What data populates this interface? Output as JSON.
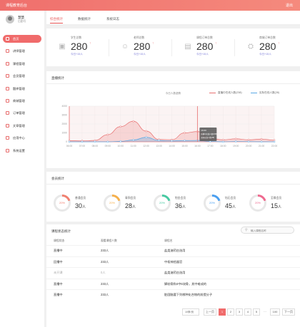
{
  "topbar": {
    "brand": "课程教育后台",
    "logout": "退出"
  },
  "user": {
    "name": "慧慧",
    "role": "后勤号"
  },
  "nav": [
    {
      "label": "首页",
      "icon": "home-icon",
      "active": true
    },
    {
      "label": "讲师管理",
      "icon": "teacher-icon"
    },
    {
      "label": "课程管理",
      "icon": "course-icon"
    },
    {
      "label": "会员管理",
      "icon": "member-icon"
    },
    {
      "label": "题库管理",
      "icon": "question-bank-icon"
    },
    {
      "label": "商城管理",
      "icon": "shop-icon"
    },
    {
      "label": "订单管理",
      "icon": "order-icon"
    },
    {
      "label": "文章管理",
      "icon": "article-icon"
    },
    {
      "label": "应用中心",
      "icon": "app-icon"
    },
    {
      "label": "系统设置",
      "icon": "settings-icon"
    }
  ],
  "tabs": [
    {
      "label": "综合统计",
      "active": true
    },
    {
      "label": "数据统计"
    },
    {
      "label": "系统日志"
    }
  ],
  "stats": [
    {
      "label": "学生总数",
      "value": "280",
      "delta": "今日+15人",
      "icon": "graduation-cap-icon"
    },
    {
      "label": "老师总数",
      "value": "280",
      "delta": "今日+15人",
      "icon": "teacher-icon"
    },
    {
      "label": "课程订单总数",
      "value": "280",
      "delta": "今日+15人",
      "icon": "book-icon"
    },
    {
      "label": "商城订单总数",
      "value": "280",
      "delta": "今日+15人",
      "icon": "cart-icon"
    }
  ],
  "live": {
    "title": "直播统计",
    "subtitle": "今日人数趋势",
    "legend": [
      "直播中在线人数(238)",
      "实际在线人数(28)"
    ],
    "tooltip": {
      "time": "16:00",
      "line1": "直播中在线人数(238)",
      "line2": "实际在线人数(28)"
    }
  },
  "chart_data": {
    "type": "area",
    "title": "今日人数趋势",
    "x": [
      "06:00",
      "07:00",
      "08:00",
      "09:00",
      "10:00",
      "11:00",
      "12:00",
      "13:00",
      "14:00",
      "15:00",
      "16:00",
      "17:00",
      "18:00",
      "19:00",
      "20:00",
      "21:00",
      "22:00"
    ],
    "series": [
      {
        "name": "直播中在线人数(238)",
        "color": "#e86f6f",
        "values": [
          120,
          100,
          150,
          800,
          1700,
          2300,
          1200,
          260,
          230,
          1000,
          1150,
          380,
          220,
          330,
          220,
          300,
          180
        ]
      },
      {
        "name": "实际在线人数(28)",
        "color": "#5aa9e6",
        "values": [
          0,
          0,
          0,
          0,
          50,
          200,
          500,
          150,
          100,
          140,
          150,
          40,
          0,
          30,
          20,
          0,
          0
        ]
      }
    ],
    "ylim": [
      0,
      4000
    ],
    "yticks": [
      0,
      1000,
      2000,
      3000,
      4000
    ],
    "grid": true,
    "legend": "top-right"
  },
  "members": {
    "title": "会员统计",
    "items": [
      {
        "label": "普通会员",
        "value": "30",
        "unit": "人",
        "percent": "20%",
        "color": "#f08070"
      },
      {
        "label": "青铜会员",
        "value": "28",
        "unit": "人",
        "percent": "20%",
        "color": "#f5b04c"
      },
      {
        "label": "铂金会员",
        "value": "36",
        "unit": "人",
        "percent": "20%",
        "color": "#47c9a2"
      },
      {
        "label": "钻石会员",
        "value": "45",
        "unit": "人",
        "percent": "20%",
        "color": "#4a9ff0"
      },
      {
        "label": "至尊会员",
        "value": "15",
        "unit": "人",
        "percent": "20%",
        "color": "#ee6a8f"
      }
    ]
  },
  "courses": {
    "title": "课程状态统计",
    "search_placeholder": "输入课程名称",
    "headers": [
      "课程状态",
      "观看课程人数",
      "课程名"
    ],
    "rows": [
      {
        "status": "直播中",
        "count": "233人",
        "name": "盐类溶药应选用"
      },
      {
        "status": "回播中",
        "count": "233人",
        "name": "中枢神经器官"
      },
      {
        "status": "未开课",
        "count": "0人",
        "name": "盐类溶药应选用",
        "muted": true
      },
      {
        "status": "直播中",
        "count": "233人",
        "name": "脚较骨和4中5块骨，其中难成的"
      },
      {
        "status": "直播中",
        "count": "233人",
        "name": "脏固脑要下列哪种化合物的前提分子"
      }
    ],
    "pager": {
      "size": "10条/页",
      "prev": "上一页",
      "pages": [
        "1",
        "2",
        "3",
        "4",
        "5",
        "…",
        "100"
      ],
      "next": "下一页"
    }
  }
}
